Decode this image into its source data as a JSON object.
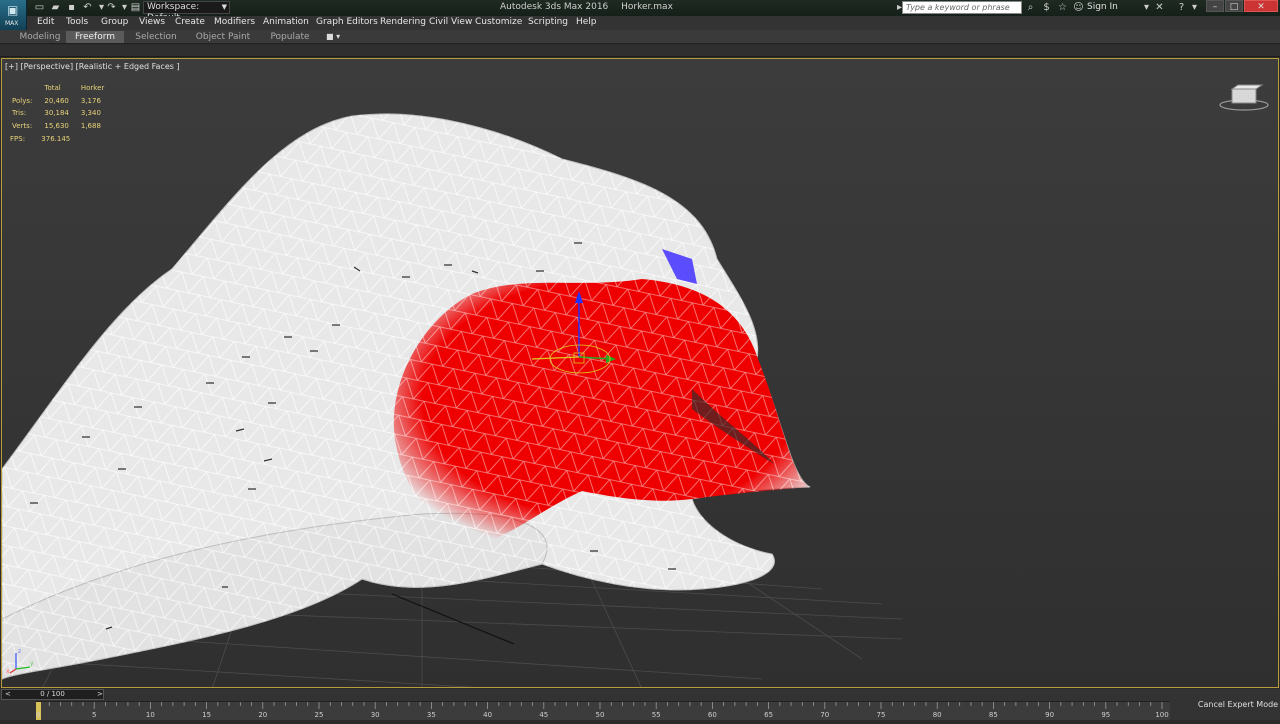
{
  "titlebar": {
    "workspace": "Workspace: Default",
    "app_title": "Autodesk 3ds Max 2016",
    "file_name": "Horker.max",
    "search_placeholder": "Type a keyword or phrase",
    "sign_in": "Sign In",
    "logo_text": "MAX"
  },
  "menu": [
    "Edit",
    "Tools",
    "Group",
    "Views",
    "Create",
    "Modifiers",
    "Animation",
    "Graph Editors",
    "Rendering",
    "Civil View",
    "Customize",
    "Scripting",
    "Help"
  ],
  "ribbon_tabs": [
    "Modeling",
    "Freeform",
    "Selection",
    "Object Paint",
    "Populate"
  ],
  "active_ribbon_tab": "Freeform",
  "viewport": {
    "label": "[+] [Perspective] [Realistic + Edged Faces ]",
    "stats": {
      "headers": [
        "Total",
        "Horker"
      ],
      "rows": [
        {
          "label": "Polys:",
          "total": "20,460",
          "object": "3,176"
        },
        {
          "label": "Tris:",
          "total": "30,184",
          "object": "3,340"
        },
        {
          "label": "Verts:",
          "total": "15,630",
          "object": "1,688"
        }
      ],
      "fps_label": "FPS:",
      "fps_value": "376.145"
    },
    "axis_labels": {
      "z": "z",
      "x": "x",
      "y": "y"
    }
  },
  "timeline": {
    "frame_display": "0 / 100",
    "ticks": [
      "0",
      "5",
      "10",
      "15",
      "20",
      "25",
      "30",
      "35",
      "40",
      "45",
      "50",
      "55",
      "60",
      "65",
      "70",
      "75",
      "80",
      "85",
      "90",
      "95",
      "100"
    ],
    "cancel_expert": "Cancel Expert Mode"
  },
  "colors": {
    "viewport_border": "#b89c3a",
    "stats_text": "#e8d27a",
    "selection_red": "#ee0000",
    "mesh_white": "#e6e6e6"
  }
}
